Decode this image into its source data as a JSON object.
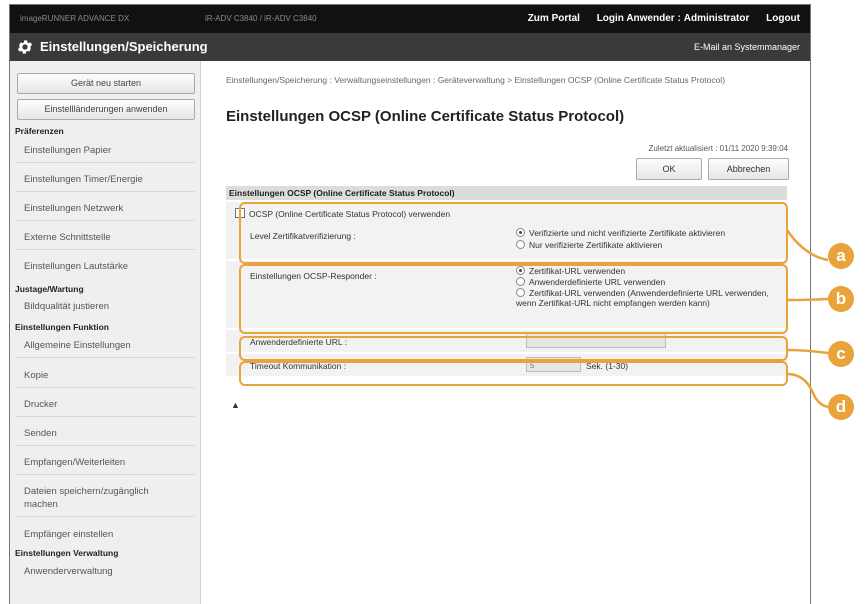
{
  "header": {
    "device_left": "imageRUNNER ADVANCE DX",
    "device_mid": "iR-ADV C3840 / iR-ADV C3840",
    "portal": "Zum Portal",
    "login_label": "Login Anwender :",
    "user": "Administrator",
    "logout": "Logout"
  },
  "titlebar": {
    "title": "Einstellungen/Speicherung",
    "mail": "E-Mail an Systemmanager"
  },
  "sidebar": {
    "restart": "Gerät neu starten",
    "apply": "Einstellländerungen anwenden",
    "sections": [
      {
        "title": "Präferenzen",
        "items": [
          "Einstellungen Papier",
          "Einstellungen Timer/Energie",
          "Einstellungen Netzwerk",
          "Externe Schnittstelle",
          "Einstellungen Lautstärke"
        ]
      },
      {
        "title": "Justage/Wartung",
        "items": [
          "Bildqualität justieren"
        ]
      },
      {
        "title": "Einstellungen Funktion",
        "items": [
          "Allgemeine Einstellungen",
          "Kopie",
          "Drucker",
          "Senden",
          "Empfangen/Weiterleiten",
          "Dateien speichern/zugänglich machen",
          "Empfänger einstellen"
        ]
      },
      {
        "title": "Einstellungen Verwaltung",
        "items": [
          "Anwenderverwaltung"
        ]
      }
    ]
  },
  "main": {
    "breadcrumb": "Einstellungen/Speicherung : Verwaltungseinstellungen : Geräteverwaltung > Einstellungen OCSP (Online Certificate Status Protocol)",
    "title": "Einstellungen OCSP (Online Certificate Status Protocol)",
    "updated": "Zuletzt aktualisiert : 01/11 2020 9:39:04",
    "ok": "OK",
    "cancel": "Abbrechen",
    "section_title": "Einstellungen OCSP (Online Certificate Status Protocol)",
    "use_ocsp": "OCSP (Online Certificate Status Protocol) verwenden",
    "level_label": "Level Zertifikatverifizierung :",
    "level_opt1": "Verifizierte und nicht verifizierte Zertifikate aktivieren",
    "level_opt2": "Nur verifizierte Zertifikate aktivieren",
    "responder_label": "Einstellungen OCSP-Responder :",
    "resp_opt1": "Zertifikat-URL verwenden",
    "resp_opt2": "Anwenderdefinierte URL verwenden",
    "resp_opt3": "Zertifikat-URL verwenden (Anwenderdefinierte URL verwenden, wenn Zertifikat-URL nicht empfangen werden kann)",
    "url_label": "Anwenderdefinierte URL :",
    "url_value": "",
    "timeout_label": "Timeout Kommunikation :",
    "timeout_value": "5",
    "timeout_unit": "Sek. (1-30)",
    "to_top": "▲"
  },
  "callouts": [
    "a",
    "b",
    "c",
    "d"
  ],
  "colors": {
    "accent": "#e8a33a",
    "header": "#111111",
    "titlebar": "#3a3a3a"
  }
}
